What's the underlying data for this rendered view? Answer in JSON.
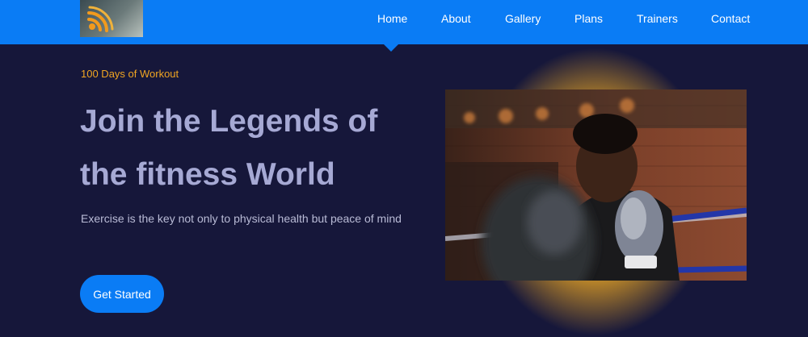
{
  "navbar": {
    "logo_icon": "wifi-icon",
    "items": [
      {
        "label": "Home",
        "active": true
      },
      {
        "label": "About"
      },
      {
        "label": "Gallery"
      },
      {
        "label": "Plans"
      },
      {
        "label": "Trainers"
      },
      {
        "label": "Contact"
      }
    ]
  },
  "hero": {
    "eyebrow": "100 Days of Workout",
    "headline_line1": "Join the Legends of",
    "headline_line2": "the fitness World",
    "subtext": "Exercise is the key not only to physical health but peace of mind",
    "cta_label": "Get Started"
  },
  "colors": {
    "nav_background": "#0a7cf5",
    "page_background": "#16173a",
    "accent_orange": "#f0a522",
    "headline_text": "#a6a9d4"
  }
}
